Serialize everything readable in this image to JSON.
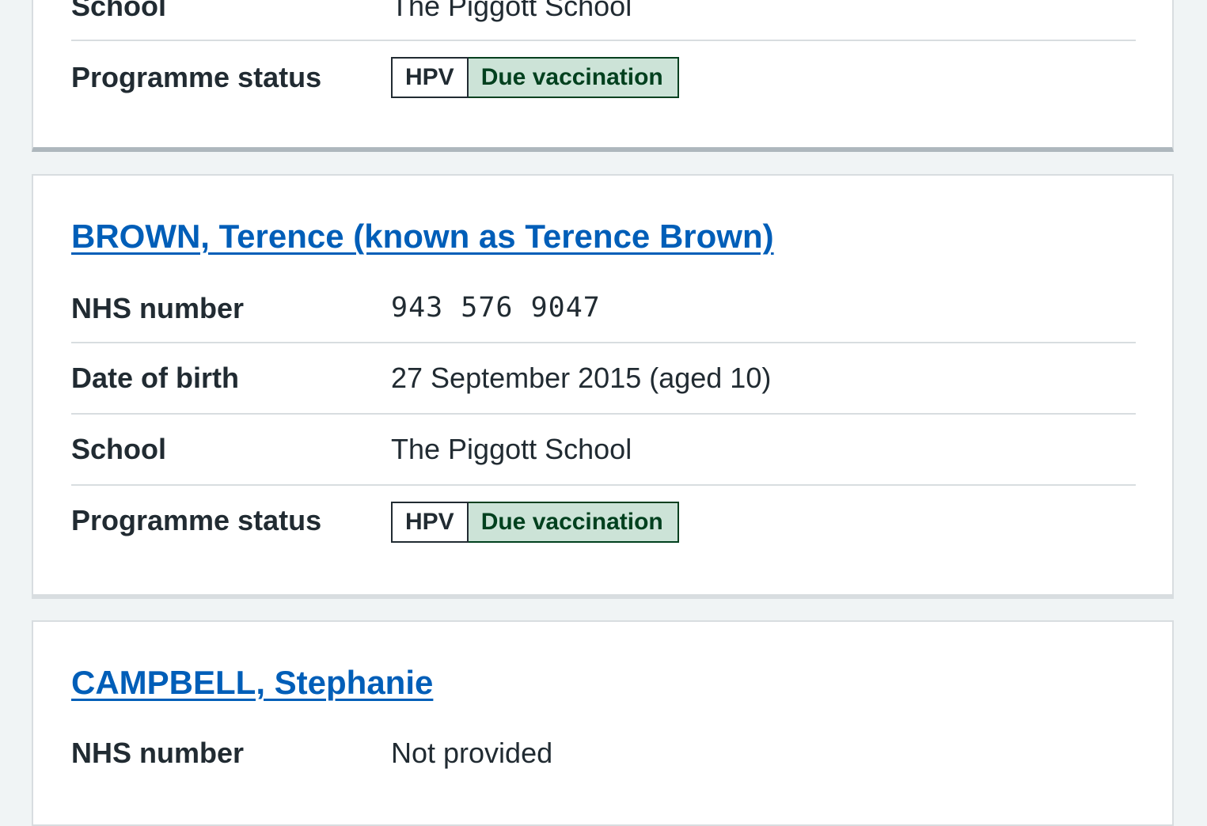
{
  "labels": {
    "nhs_number": "NHS number",
    "date_of_birth": "Date of birth",
    "school": "School",
    "programme_status": "Programme status"
  },
  "patients": [
    {
      "school": "The Piggott School",
      "programme": "HPV",
      "status": "Due vaccination"
    },
    {
      "name": "BROWN, Terence (known as Terence Brown)",
      "nhs_number": "943 576 9047",
      "date_of_birth": "27 September 2015 (aged 10)",
      "school": "The Piggott School",
      "programme": "HPV",
      "status": "Due vaccination"
    },
    {
      "name": "CAMPBELL, Stephanie",
      "nhs_number": "Not provided"
    }
  ],
  "colors": {
    "page_background": "#f0f4f5",
    "link": "#005eb8",
    "status_green_bg": "#cce3d7",
    "status_green_text": "#00401e",
    "text": "#212b32"
  }
}
